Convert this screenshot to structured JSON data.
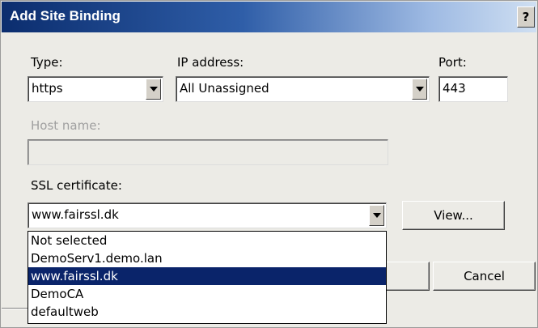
{
  "window": {
    "title": "Add Site Binding",
    "help_label": "?"
  },
  "form": {
    "type_label": "Type:",
    "type_value": "https",
    "ip_label": "IP address:",
    "ip_value": "All Unassigned",
    "port_label": "Port:",
    "port_value": "443",
    "hostname_label": "Host name:",
    "hostname_value": "",
    "ssl_label": "SSL certificate:",
    "ssl_value": "www.fairssl.dk",
    "view_button": "View..."
  },
  "ssl_dropdown": {
    "options": [
      "Not selected",
      "DemoServ1.demo.lan",
      "www.fairssl.dk",
      "DemoCA",
      "defaultweb"
    ],
    "selected_index": 2
  },
  "buttons": {
    "ok_label": "",
    "cancel_label": "Cancel"
  },
  "colors": {
    "title_gradient_start": "#0b2d6e",
    "selection": "#0a246a",
    "dialog_bg": "#ecebe6"
  }
}
